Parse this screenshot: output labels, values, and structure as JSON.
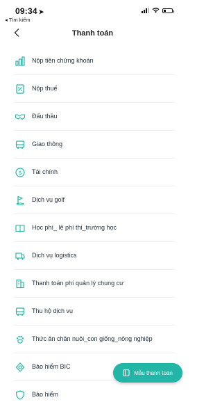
{
  "status_bar": {
    "time": "09:34",
    "back_app": "◂ Tìm kiếm"
  },
  "header": {
    "title": "Thanh toán",
    "back_icon": "chevron-left-icon"
  },
  "items": [
    {
      "label": "Nộp tiền chứng khoán",
      "icon": "chart-bar-icon"
    },
    {
      "label": "Nộp thuế",
      "icon": "tax-document-icon"
    },
    {
      "label": "Đấu thầu",
      "icon": "handshake-icon"
    },
    {
      "label": "Giao thông",
      "icon": "bus-icon"
    },
    {
      "label": "Tài chính",
      "icon": "dollar-coin-icon"
    },
    {
      "label": "Dịch vụ golf",
      "icon": "golf-flag-icon"
    },
    {
      "label": "Học phí_ lệ phí thi_trường học",
      "icon": "book-icon"
    },
    {
      "label": "Dịch vụ logistics",
      "icon": "truck-icon"
    },
    {
      "label": "Thanh toán phí quản lý chung cư",
      "icon": "building-icon"
    },
    {
      "label": "Thu hộ dịch vụ",
      "icon": "bus-icon"
    },
    {
      "label": "Thức ăn chăn nuôi_con giống_nông nghiệp",
      "icon": "paw-icon"
    },
    {
      "label": "Bảo hiểm BIC",
      "icon": "shield-icon"
    },
    {
      "label": "Bảo hiểm",
      "icon": "shield-icon"
    }
  ],
  "fab": {
    "label": "Mẫu thanh toán",
    "icon": "template-icon"
  },
  "colors": {
    "accent": "#23b5a5",
    "icon": "#23b5a5",
    "text": "#1f2d3d"
  }
}
